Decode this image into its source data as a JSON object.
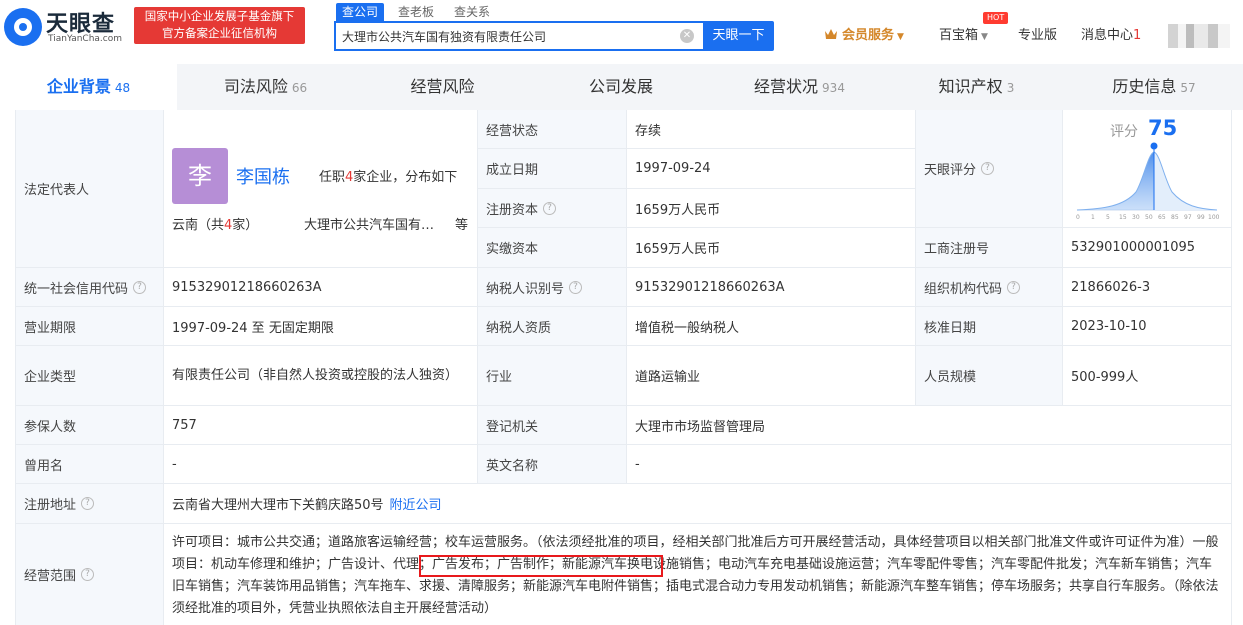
{
  "header": {
    "logo_cn": "天眼查",
    "logo_en": "TianYanCha.com",
    "badge_line1": "国家中小企业发展子基金旗下",
    "badge_line2": "官方备案企业征信机构",
    "search_tabs": [
      "查公司",
      "查老板",
      "查关系"
    ],
    "search_value": "大理市公共汽车国有独资有限责任公司",
    "search_button": "天眼一下",
    "vip": "会员服务",
    "treasure": "百宝箱",
    "hot": "HOT",
    "pro": "专业版",
    "messages": "消息中心",
    "message_count": "1"
  },
  "tabs": [
    {
      "label": "企业背景",
      "count": "48"
    },
    {
      "label": "司法风险",
      "count": "66"
    },
    {
      "label": "经营风险",
      "count": ""
    },
    {
      "label": "公司发展",
      "count": ""
    },
    {
      "label": "经营状况",
      "count": "934"
    },
    {
      "label": "知识产权",
      "count": "3"
    },
    {
      "label": "历史信息",
      "count": "57"
    }
  ],
  "labels": {
    "legal_rep": "法定代表人",
    "status": "经营状态",
    "founded": "成立日期",
    "reg_capital": "注册资本",
    "paid_capital": "实缴资本",
    "tianyan_score": "天眼评分",
    "business_reg_no": "工商注册号",
    "credit_code": "统一社会信用代码",
    "taxpayer_id": "纳税人识别号",
    "org_code": "组织机构代码",
    "business_term": "营业期限",
    "taxpayer_qual": "纳税人资质",
    "approval_date": "核准日期",
    "company_type": "企业类型",
    "industry": "行业",
    "staff_size": "人员规模",
    "insured": "参保人数",
    "reg_authority": "登记机关",
    "former_name": "曾用名",
    "english_name": "英文名称",
    "reg_address": "注册地址",
    "business_scope": "经营范围"
  },
  "values": {
    "rep_avatar": "李",
    "rep_name": "李国栋",
    "rep_info_pre": "任职",
    "rep_info_num": "4",
    "rep_info_post": "家企业，分布如下",
    "rep_region_pre": "云南（共",
    "rep_region_num": "4",
    "rep_region_post": "家）",
    "rep_company": "大理市公共汽车国有独资有限责任公司",
    "rep_etc": "等",
    "status": "存续",
    "founded": "1997-09-24",
    "reg_capital": "1659万人民币",
    "paid_capital": "1659万人民币",
    "score_label": "评分",
    "score": "75",
    "business_reg_no": "532901000001095",
    "credit_code": "91532901218660263A",
    "taxpayer_id": "91532901218660263A",
    "org_code": "21866026-3",
    "business_term": "1997-09-24 至 无固定期限",
    "taxpayer_qual": "增值税一般纳税人",
    "approval_date": "2023-10-10",
    "company_type": "有限责任公司（非自然人投资或控股的法人独资）",
    "industry": "道路运输业",
    "staff_size": "500-999人",
    "insured": "757",
    "reg_authority": "大理市市场监督管理局",
    "former_name": "-",
    "english_name": "-",
    "reg_address": "云南省大理州大理市下关鹤庆路50号",
    "nearby": "附近公司",
    "scope_part1": "许可项目：城市公共交通；道路旅客运输经营；校车运营服务。（依法须经批准的项目，经相关部门批准后方可开展经营活动，具体经营项目以相关部门批准文件或许可证件为准）一般项目：机动车修理和维护；",
    "scope_highlight": "广告设计、代理；广告发布；广告制作",
    "scope_part2": "；新能源汽车换电设施销售；电动汽车充电基础设施运营；汽车零配件零售；汽车零配件批发；汽车新车销售；汽车旧车销售；汽车装饰用品销售；汽车拖车、求援、清障服务；新能源汽车电附件销售；插电式混合动力专用发动机销售；新能源汽车整车销售；停车场服务；共享自行车服务。（除依法须经批准的项目外，凭营业执照依法自主开展经营活动）"
  },
  "score_chart": {
    "ticks": [
      "0",
      "1",
      "5",
      "15",
      "30",
      "50",
      "65",
      "85",
      "97",
      "99",
      "100"
    ]
  }
}
